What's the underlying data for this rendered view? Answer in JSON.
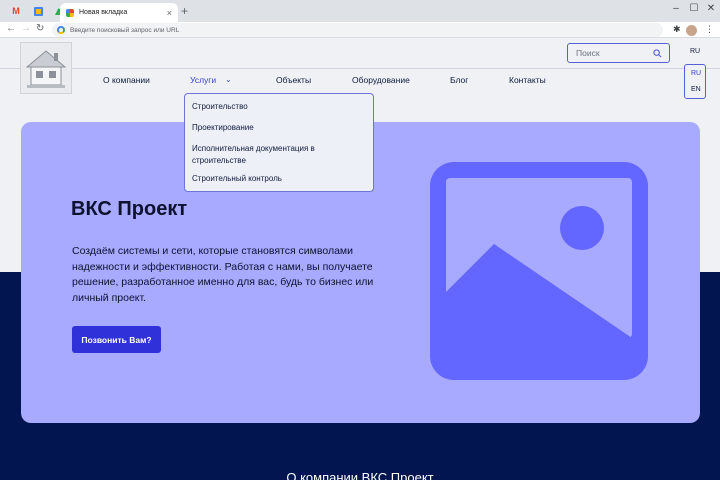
{
  "browser": {
    "tab_title": "Новая вкладка",
    "tab_close": "×",
    "new_tab": "+",
    "pinned_tabs": [
      "M",
      "",
      ""
    ],
    "window_controls": [
      "–",
      "☐",
      "✕"
    ],
    "omnibox_placeholder": "Введите поисковый запрос или URL",
    "nav": {
      "back": "←",
      "forward": "→",
      "reload": "↻"
    },
    "toolbar_icons": [
      "extensions-icon",
      "menu-icon"
    ],
    "menu_glyph": "⋮",
    "extensions_glyph": "✱"
  },
  "site": {
    "nav_items": [
      "О компании",
      "Услуги",
      "Объекты",
      "Оборудование",
      "Блог",
      "Контакты"
    ],
    "active_nav": "Услуги",
    "chevron": "⌄",
    "search_placeholder": "Поиск",
    "lang_current": "RU",
    "lang_options": [
      "RU",
      "EN"
    ]
  },
  "dropdown": {
    "items": [
      "Строительство",
      "Проектирование",
      "Исполнительная документация в строительстве",
      "Строительный контроль"
    ]
  },
  "hero": {
    "title": "ВКС Проект",
    "text": "Создаём системы и сети, которые становятся символами надежности и эффективности. Работая с нами, вы получаете решение, разработанное именно для вас, будь то бизнес или личный проект.",
    "cta_label": "Позвонить Вам?",
    "image_icon": "image-placeholder-icon"
  },
  "about": {
    "heading": "О компании ВКС Проект"
  },
  "colors": {
    "accent": "#3131d9",
    "hero_bg": "#a7aafe",
    "hero_icon": "#6366ff",
    "dark_bg": "#031550",
    "light_bg": "#eff1f5"
  }
}
